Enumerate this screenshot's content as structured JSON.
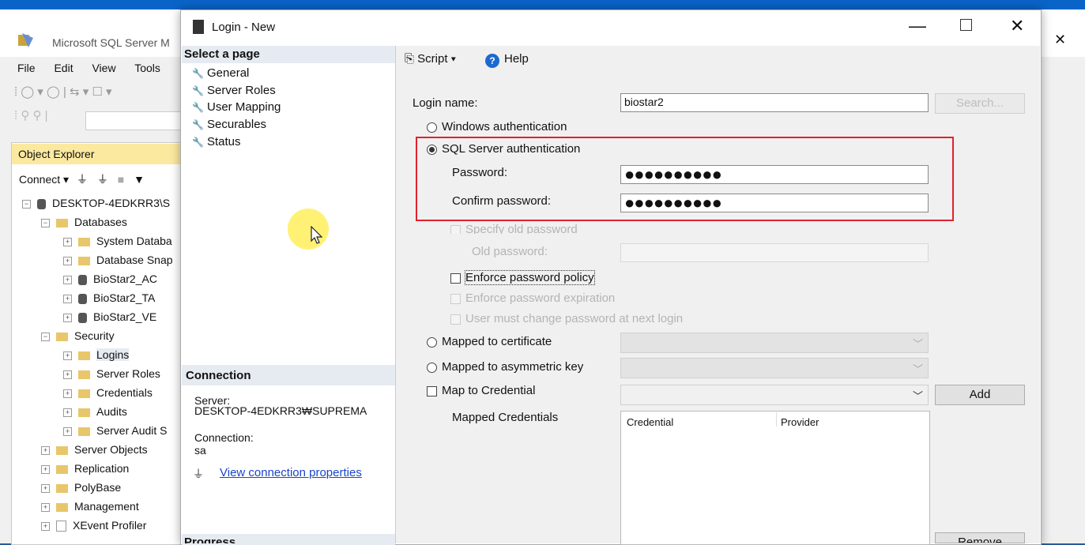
{
  "ssms": {
    "title": "Microsoft SQL Server M",
    "menu": [
      "File",
      "Edit",
      "View",
      "Tools"
    ],
    "close": "✕"
  },
  "object_explorer": {
    "title": "Object Explorer",
    "connect": "Connect ▾",
    "tree": [
      {
        "label": "DESKTOP-4EDKRR3\\S",
        "indent": 0,
        "type": "server",
        "exp": "⊟"
      },
      {
        "label": "Databases",
        "indent": 1,
        "type": "folder",
        "exp": "⊟"
      },
      {
        "label": "System Databa",
        "indent": 2,
        "type": "folder",
        "exp": "⊞"
      },
      {
        "label": "Database Snap",
        "indent": 2,
        "type": "folder",
        "exp": "⊞"
      },
      {
        "label": "BioStar2_AC",
        "indent": 2,
        "type": "db",
        "exp": "⊞"
      },
      {
        "label": "BioStar2_TA",
        "indent": 2,
        "type": "db",
        "exp": "⊞"
      },
      {
        "label": "BioStar2_VE",
        "indent": 2,
        "type": "db",
        "exp": "⊞"
      },
      {
        "label": "Security",
        "indent": 1,
        "type": "folder",
        "exp": "⊟"
      },
      {
        "label": "Logins",
        "indent": 2,
        "type": "folder",
        "exp": "⊞"
      },
      {
        "label": "Server Roles",
        "indent": 2,
        "type": "folder",
        "exp": "⊞"
      },
      {
        "label": "Credentials",
        "indent": 2,
        "type": "folder",
        "exp": "⊞"
      },
      {
        "label": "Audits",
        "indent": 2,
        "type": "folder",
        "exp": "⊞"
      },
      {
        "label": "Server Audit S",
        "indent": 2,
        "type": "folder",
        "exp": "⊞"
      },
      {
        "label": "Server Objects",
        "indent": 1,
        "type": "folder",
        "exp": "⊞"
      },
      {
        "label": "Replication",
        "indent": 1,
        "type": "folder",
        "exp": "⊞"
      },
      {
        "label": "PolyBase",
        "indent": 1,
        "type": "folder",
        "exp": "⊞"
      },
      {
        "label": "Management",
        "indent": 1,
        "type": "folder",
        "exp": "⊞"
      },
      {
        "label": "XEvent Profiler",
        "indent": 1,
        "type": "xevent",
        "exp": "⊞"
      }
    ]
  },
  "dialog": {
    "title": "Login - New",
    "minimize": "—",
    "close": "✕",
    "select_page": "Select a page",
    "pages": [
      "General",
      "Server Roles",
      "User Mapping",
      "Securables",
      "Status"
    ],
    "connection_title": "Connection",
    "server_label": "Server:",
    "server_value": "DESKTOP-4EDKRR3₩SUPREMA",
    "connection_label": "Connection:",
    "connection_value": "sa",
    "view_connection": "View connection properties",
    "progress_title": "Progress",
    "script": "Script",
    "help": "Help",
    "login_name_label": "Login name:",
    "login_name_value": "biostar2",
    "search_button": "Search...",
    "windows_auth": "Windows authentication",
    "sql_auth": "SQL Server authentication",
    "password_label": "Password:",
    "password_value": "●●●●●●●●●●",
    "confirm_label": "Confirm password:",
    "confirm_value": "●●●●●●●●●●",
    "specify_old": "Specify old password",
    "old_password_label": "Old password:",
    "enforce_policy": "Enforce password policy",
    "enforce_expiration": "Enforce password expiration",
    "must_change": "User must change password at next login",
    "mapped_cert": "Mapped to certificate",
    "mapped_asym": "Mapped to asymmetric key",
    "map_credential": "Map to Credential",
    "add_button": "Add",
    "mapped_credentials": "Mapped Credentials",
    "col_credential": "Credential",
    "col_provider": "Provider",
    "remove_button": "Remove"
  },
  "colors": {
    "highlight_box": "#e0222e",
    "link": "#1a45c8"
  }
}
